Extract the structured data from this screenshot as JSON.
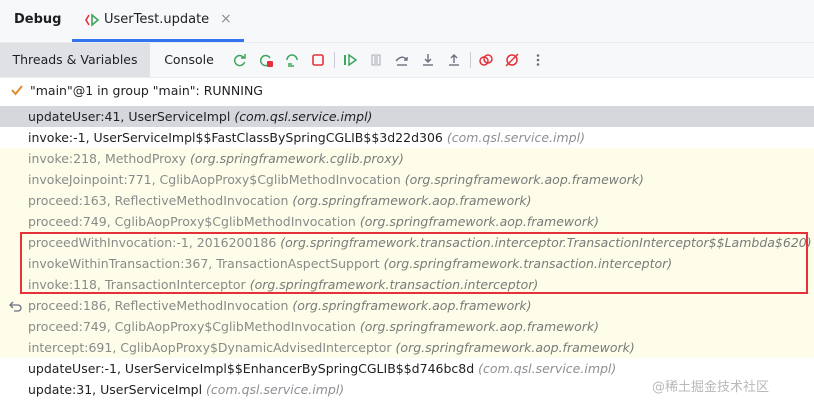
{
  "titlebar": {
    "title": "Debug",
    "tab_label": "UserTest.update",
    "tab_close": "×",
    "tab_icon": "run-config-icon"
  },
  "toolbar": {
    "tabs": [
      "Threads & Variables",
      "Console"
    ],
    "icons": [
      "rerun-icon",
      "stop-rerun-icon",
      "rerun-failed-icon",
      "stop-icon",
      "resume-icon",
      "pause-icon",
      "step-over-icon",
      "step-into-icon",
      "step-out-icon",
      "view-breakpoints-icon",
      "mute-breakpoints-icon",
      "more-icon"
    ]
  },
  "thread": {
    "label": "\"main\"@1 in group \"main\": RUNNING"
  },
  "frames": [
    {
      "method": "updateUser:41, UserServiceImpl ",
      "pkg": "(com.qsl.service.impl)",
      "kind": "selected"
    },
    {
      "method": "invoke:-1, UserServiceImpl$$FastClassBySpringCGLIB$$3d22d306 ",
      "pkg": "(com.qsl.service.impl)",
      "kind": "app"
    },
    {
      "method": "invoke:218, MethodProxy ",
      "pkg": "(org.springframework.cglib.proxy)",
      "kind": "lib"
    },
    {
      "method": "invokeJoinpoint:771, CglibAopProxy$CglibMethodInvocation ",
      "pkg": "(org.springframework.aop.framework)",
      "kind": "lib"
    },
    {
      "method": "proceed:163, ReflectiveMethodInvocation ",
      "pkg": "(org.springframework.aop.framework)",
      "kind": "lib"
    },
    {
      "method": "proceed:749, CglibAopProxy$CglibMethodInvocation ",
      "pkg": "(org.springframework.aop.framework)",
      "kind": "lib"
    },
    {
      "method": "proceedWithInvocation:-1, 2016200186 ",
      "pkg": "(org.springframework.transaction.interceptor.TransactionInterceptor$$Lambda$620)",
      "kind": "lib"
    },
    {
      "method": "invokeWithinTransaction:367, TransactionAspectSupport ",
      "pkg": "(org.springframework.transaction.interceptor)",
      "kind": "lib"
    },
    {
      "method": "invoke:118, TransactionInterceptor ",
      "pkg": "(org.springframework.transaction.interceptor)",
      "kind": "lib"
    },
    {
      "method": "proceed:186, ReflectiveMethodInvocation ",
      "pkg": "(org.springframework.aop.framework)",
      "kind": "lib",
      "restart_icon": true
    },
    {
      "method": "proceed:749, CglibAopProxy$CglibMethodInvocation ",
      "pkg": "(org.springframework.aop.framework)",
      "kind": "lib"
    },
    {
      "method": "intercept:691, CglibAopProxy$DynamicAdvisedInterceptor ",
      "pkg": "(org.springframework.aop.framework)",
      "kind": "lib"
    },
    {
      "method": "updateUser:-1, UserServiceImpl$$EnhancerBySpringCGLIB$$d746bc8d ",
      "pkg": "(com.qsl.service.impl)",
      "kind": "app"
    },
    {
      "method": "update:31, UserServiceImpl ",
      "pkg": "(com.qsl.service.impl)",
      "kind": "app"
    }
  ],
  "watermark": "@稀土掘金技术社区",
  "colors": {
    "accent": "#3574f0",
    "highlight_box": "#e5323a",
    "library_row_bg": "#fdfde9",
    "selected_row_bg": "#d5d7dd"
  }
}
